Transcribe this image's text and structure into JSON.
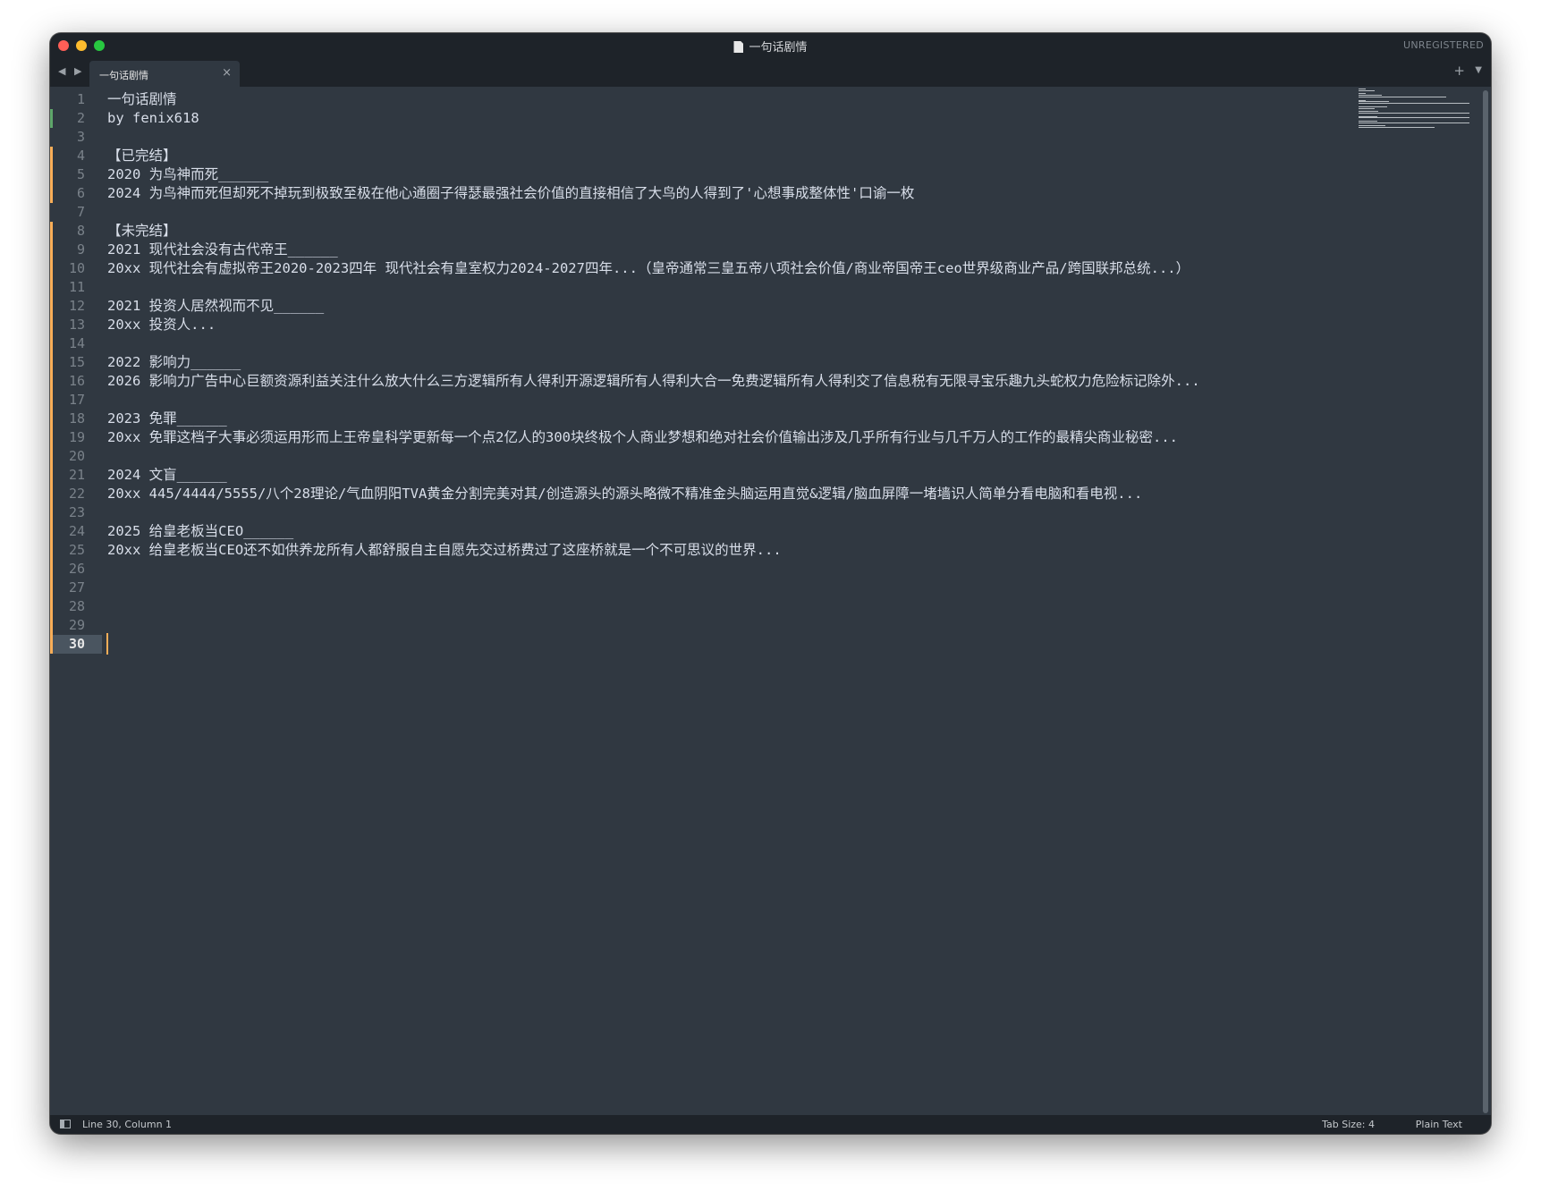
{
  "window": {
    "title": "一句话剧情",
    "unregistered_label": "UNREGISTERED"
  },
  "tabbar": {
    "nav_arrows": "◀ ▶",
    "tabs": [
      {
        "label": "一句话剧情",
        "close_glyph": "×"
      }
    ],
    "new_tab_glyph": "+",
    "menu_glyph": "▼"
  },
  "editor": {
    "current_line": 30,
    "lines": [
      {
        "n": "1",
        "text": "一句话剧情",
        "mark": ""
      },
      {
        "n": "2",
        "text": "by fenix618",
        "mark": "added"
      },
      {
        "n": "3",
        "text": "",
        "mark": ""
      },
      {
        "n": "4",
        "text": "【已完结】",
        "mark": "modified"
      },
      {
        "n": "5",
        "text": "2020 为鸟神而死______",
        "mark": "modified"
      },
      {
        "n": "6",
        "text": "2024 为鸟神而死但却死不掉玩到极致至极在他心通圈子得瑟最强社会价值的直接相信了大鸟的人得到了'心想事成整体性'口谕一枚",
        "mark": "modified"
      },
      {
        "n": "7",
        "text": "",
        "mark": ""
      },
      {
        "n": "8",
        "text": "【未完结】",
        "mark": "modified"
      },
      {
        "n": "9",
        "text": "2021 现代社会没有古代帝王______",
        "mark": "modified"
      },
      {
        "n": "10",
        "text": "20xx 现代社会有虚拟帝王2020-2023四年 现代社会有皇室权力2024-2027四年...（皇帝通常三皇五帝八项社会价值/商业帝国帝王ceo世界级商业产品/跨国联邦总统...）",
        "mark": "modified"
      },
      {
        "n": "11",
        "text": "",
        "mark": "modified"
      },
      {
        "n": "12",
        "text": "2021 投资人居然视而不见______",
        "mark": "modified"
      },
      {
        "n": "13",
        "text": "20xx 投资人...",
        "mark": "modified"
      },
      {
        "n": "14",
        "text": "",
        "mark": "modified"
      },
      {
        "n": "15",
        "text": "2022 影响力______",
        "mark": "modified"
      },
      {
        "n": "16",
        "text": "2026 影响力广告中心巨额资源利益关注什么放大什么三方逻辑所有人得利开源逻辑所有人得利大合一免费逻辑所有人得利交了信息税有无限寻宝乐趣九头蛇权力危险标记除外...",
        "mark": "modified"
      },
      {
        "n": "17",
        "text": "",
        "mark": "modified"
      },
      {
        "n": "18",
        "text": "2023 免罪______",
        "mark": "modified"
      },
      {
        "n": "19",
        "text": "20xx 免罪这档子大事必须运用形而上王帝皇科学更新每一个点2亿人的300块终极个人商业梦想和绝对社会价值输出涉及几乎所有行业与几千万人的工作的最精尖商业秘密...",
        "mark": "modified"
      },
      {
        "n": "20",
        "text": "",
        "mark": "modified"
      },
      {
        "n": "21",
        "text": "2024 文盲______",
        "mark": "modified"
      },
      {
        "n": "22",
        "text": "20xx 445/4444/5555/八个28理论/气血阴阳TVA黄金分割完美对其/创造源头的源头略微不精准金头脑运用直觉&逻辑/脑血屏障一堵墙识人简单分看电脑和看电视...",
        "mark": "modified"
      },
      {
        "n": "23",
        "text": "",
        "mark": "modified"
      },
      {
        "n": "24",
        "text": "2025 给皇老板当CEO______",
        "mark": "modified"
      },
      {
        "n": "25",
        "text": "20xx 给皇老板当CEO还不如供养龙所有人都舒服自主自愿先交过桥费过了这座桥就是一个不可思议的世界...",
        "mark": "modified"
      },
      {
        "n": "26",
        "text": "",
        "mark": "modified"
      },
      {
        "n": "27",
        "text": "",
        "mark": "modified"
      },
      {
        "n": "28",
        "text": "",
        "mark": "modified"
      },
      {
        "n": "29",
        "text": "",
        "mark": "modified"
      },
      {
        "n": "30",
        "text": "",
        "mark": "modified"
      }
    ]
  },
  "statusbar": {
    "position": "Line 30, Column 1",
    "tab_size": "Tab Size: 4",
    "syntax": "Plain Text"
  },
  "colors": {
    "background": "#303841",
    "chrome": "#1e2329",
    "text": "#d8dee9",
    "gutter_added": "#5ea66a",
    "gutter_modified": "#f9ae58",
    "caret": "#f9ae58"
  }
}
